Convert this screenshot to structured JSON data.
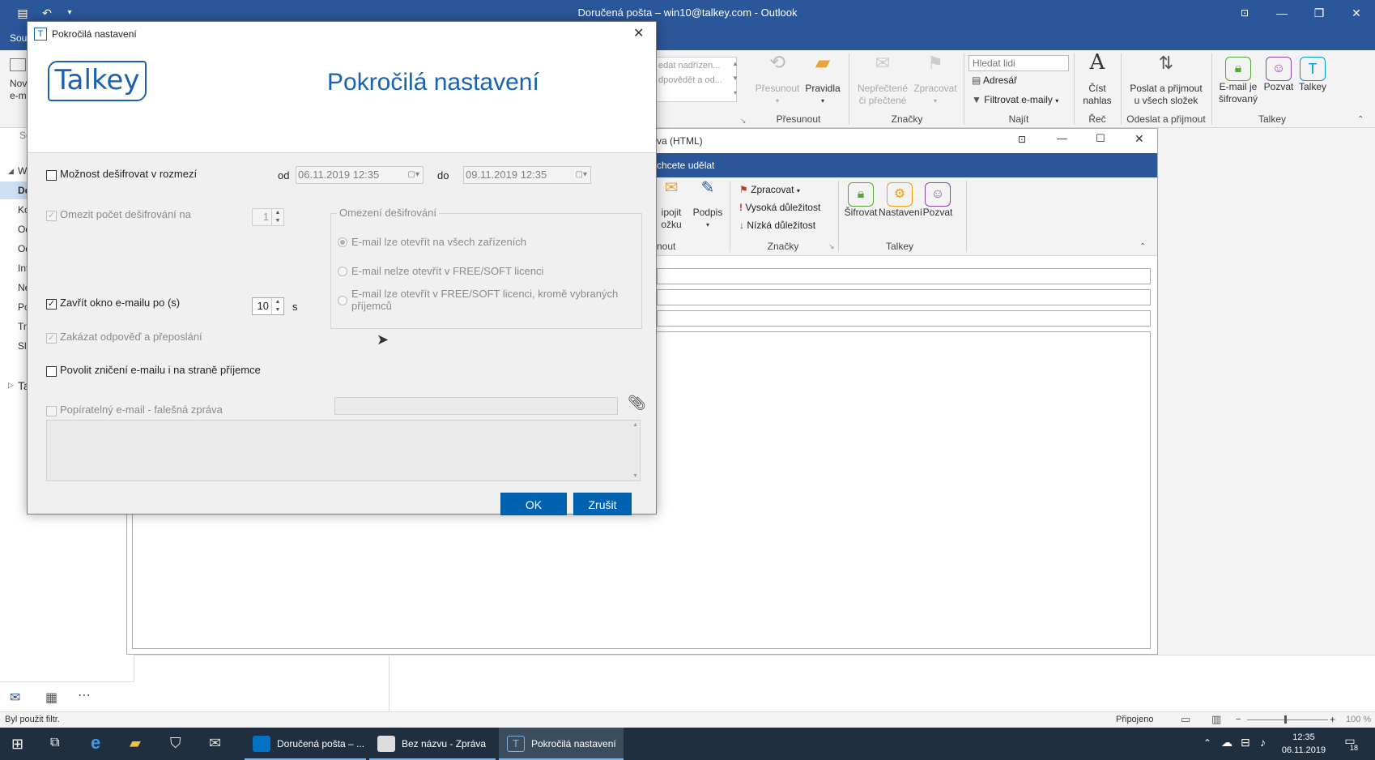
{
  "app": {
    "window_title": "Doručená pošta – win10@talkey.com  -  Outlook",
    "tab_partial": "Sou"
  },
  "ribbon": {
    "new_email_partial": [
      "Nov",
      "e-m"
    ],
    "quick_steps_partial": [
      "edat nadřízen...",
      "dpovědět a od..."
    ],
    "move_label": "Přesunout",
    "rules_label": "Pravidla",
    "move_group": "Přesunout",
    "unread_label": [
      "Nepřečtené",
      "či přečtené"
    ],
    "followup_label": "Zpracovat",
    "tags_group": "Značky",
    "search_people_placeholder": "Hledat lidi",
    "address_book_label": "Adresář",
    "filter_email_label": "Filtrovat e-maily",
    "find_group": "Najít",
    "read_aloud_label": [
      "Číst",
      "nahlas"
    ],
    "speech_group": "Řeč",
    "send_receive_label": [
      "Poslat a přijmout",
      "u všech složek"
    ],
    "send_receive_group": "Odeslat a přijmout",
    "encrypted_label": [
      "E-mail je",
      "šifrovaný"
    ],
    "invite_label": "Pozvat",
    "talkey_label": "Talkey",
    "talkey_group": "Talkey"
  },
  "navpane": {
    "search_partial": "Se",
    "items": [
      "W",
      "Do",
      "Ko",
      "Od",
      "Od",
      "Int",
      "Ne",
      "Po",
      "Tra",
      "Slo",
      "Ta"
    ]
  },
  "compose": {
    "title_partial": "va (HTML)",
    "tell_me": "chcete udělat",
    "attach_partial": [
      "ipojit",
      "ožku"
    ],
    "signature_label": "Podpis",
    "group_partial": "rnout",
    "followup_label": "Zpracovat",
    "high_importance": "Vysoká důležitost",
    "low_importance": "Nízká důležitost",
    "tags_group": "Značky",
    "encrypt_label": "Šifrovat",
    "settings_label": "Nastavení",
    "invite_label": "Pozvat",
    "talkey_group": "Talkey"
  },
  "statusbar": {
    "filter_text": "Byl použit filtr.",
    "connected": "Připojeno",
    "zoom": "100 %"
  },
  "taskbar": {
    "items": [
      "Doručená pošta – ...",
      "Bez názvu - Zpráva ...",
      "Pokročilá nastavení"
    ],
    "time": "12:35",
    "date": "06.11.2019",
    "notifications": "18"
  },
  "dialog": {
    "title": "Pokročilá nastavení",
    "logo_text": "Talkey",
    "heading": "Pokročilá nastavení",
    "decrypt_range_label": "Možnost dešifrovat v rozmezí",
    "from_label": "od",
    "from_value": "06.11.2019 12:35",
    "to_label": "do",
    "to_value": "09.11.2019 12:35",
    "limit_count_label": "Omezit počet dešifrování na",
    "limit_count_value": "1",
    "decrypt_limits_group": "Omezení dešifrování",
    "radio_all_devices": "E-mail lze otevřít na všech zařízeních",
    "radio_not_free": "E-mail nelze otevřít v FREE/SOFT licenci",
    "radio_free_except": [
      "E-mail lze otevřít v FREE/SOFT licenci, kromě vybraných",
      "příjemců"
    ],
    "close_after_label": "Zavřít okno e-mailu po (s)",
    "close_after_value": "10",
    "seconds_unit": "s",
    "disable_reply_label": "Zakázat odpověď a přeposlání",
    "allow_destroy_label": "Povolit zničení e-mailu i na straně příjemce",
    "deniable_label": "Popíratelný e-mail - falešná zpráva",
    "ok_label": "OK",
    "cancel_label": "Zrušit"
  },
  "colors": {
    "outlook_blue": "#2b579a",
    "talkey_blue": "#1a62ad",
    "button_blue": "#0063b1",
    "talkey_green": "#5aa33a",
    "talkey_orange": "#f39c12",
    "talkey_purple": "#8e44ad",
    "talkey_teal": "#0099cc"
  }
}
